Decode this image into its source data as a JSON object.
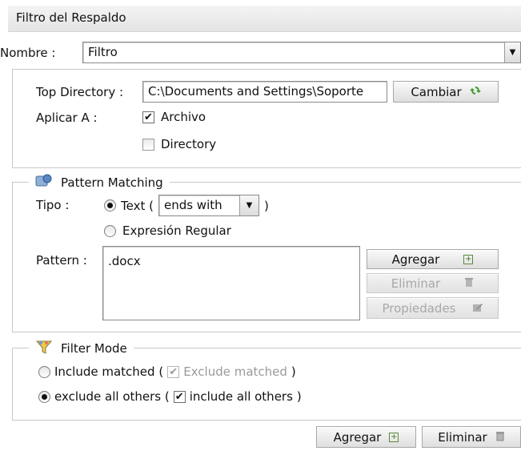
{
  "window": {
    "title": "Filtro del Respaldo"
  },
  "nombre": {
    "label": "Nombre :",
    "value": "Filtro"
  },
  "top_directory": {
    "label": "Top Directory :",
    "value": "C:\\Documents and Settings\\Soporte",
    "cambiar_label": "Cambiar"
  },
  "aplicar": {
    "label": "Aplicar A :",
    "archivo_label": "Archivo",
    "archivo_checked": true,
    "directory_label": "Directory",
    "directory_checked": false
  },
  "pattern_matching": {
    "legend": "Pattern Matching",
    "tipo_label": "Tipo :",
    "text_option_prefix": "Text (",
    "text_option_suffix": ")",
    "text_selected": true,
    "ends_with_value": "ends with",
    "regex_option": "Expresión Regular",
    "pattern_label": "Pattern :",
    "pattern_value": ".docx",
    "agregar_label": "Agregar",
    "eliminar_label": "Eliminar",
    "propiedades_label": "Propiedades"
  },
  "filter_mode": {
    "legend": "Filter Mode",
    "include_matched_prefix": "Include matched (",
    "exclude_matched_label": "Exclude matched",
    "exclude_matched_checked": true,
    "include_matched_suffix": ")",
    "include_matched_selected": false,
    "exclude_all_prefix": "exclude all others (",
    "include_all_label": "include all others",
    "include_all_checked": true,
    "exclude_all_suffix": ")",
    "exclude_all_selected": true
  },
  "footer": {
    "agregar_label": "Agregar",
    "eliminar_label": "Eliminar"
  },
  "colors": {
    "accent_green": "#3d7a22",
    "disabled_text": "#a8a8a8"
  },
  "icons": [
    "refresh-icon",
    "pattern-matching-icon",
    "filter-mode-icon",
    "add-icon",
    "trash-icon",
    "properties-icon",
    "dropdown-arrow-icon"
  ]
}
